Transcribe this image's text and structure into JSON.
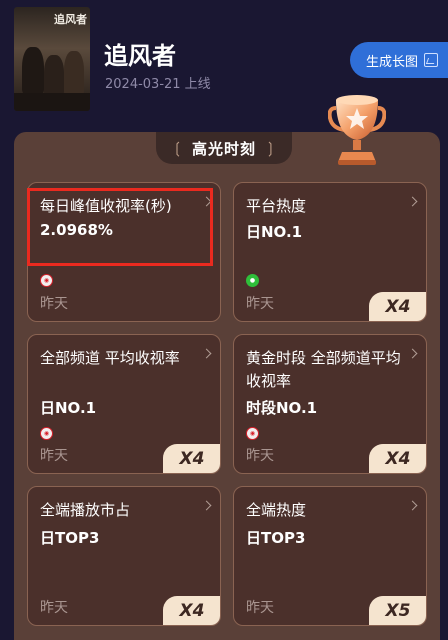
{
  "show": {
    "poster_title": "追风者",
    "title": "追风者",
    "release": "2024-03-21 上线",
    "generate_button": "生成长图"
  },
  "highlights": {
    "title": "高光时刻",
    "cards": [
      {
        "title": "每日峰值收视率(秒)",
        "value": "2.0968%",
        "logo": "red",
        "date": "昨天",
        "badge": ""
      },
      {
        "title": "平台热度",
        "value": "日NO.1",
        "logo": "green",
        "date": "昨天",
        "badge": "X4"
      },
      {
        "title": "全部频道 平均收视率",
        "value": "日NO.1",
        "logo": "red",
        "date": "昨天",
        "badge": "X4"
      },
      {
        "title": "黄金时段 全部频道平均收视率",
        "value": "时段NO.1",
        "logo": "red",
        "date": "昨天",
        "badge": "X4"
      },
      {
        "title": "全端播放市占",
        "value": "日TOP3",
        "logo": "",
        "date": "昨天",
        "badge": "X4"
      },
      {
        "title": "全端热度",
        "value": "日TOP3",
        "logo": "",
        "date": "昨天",
        "badge": "X5"
      }
    ]
  },
  "colors": {
    "accent_button": "#2f6fd8",
    "highlight_box": "#ea2a1f",
    "panel": "#5a4038",
    "card": "#4b302b",
    "badge": "#f5e4cf"
  }
}
